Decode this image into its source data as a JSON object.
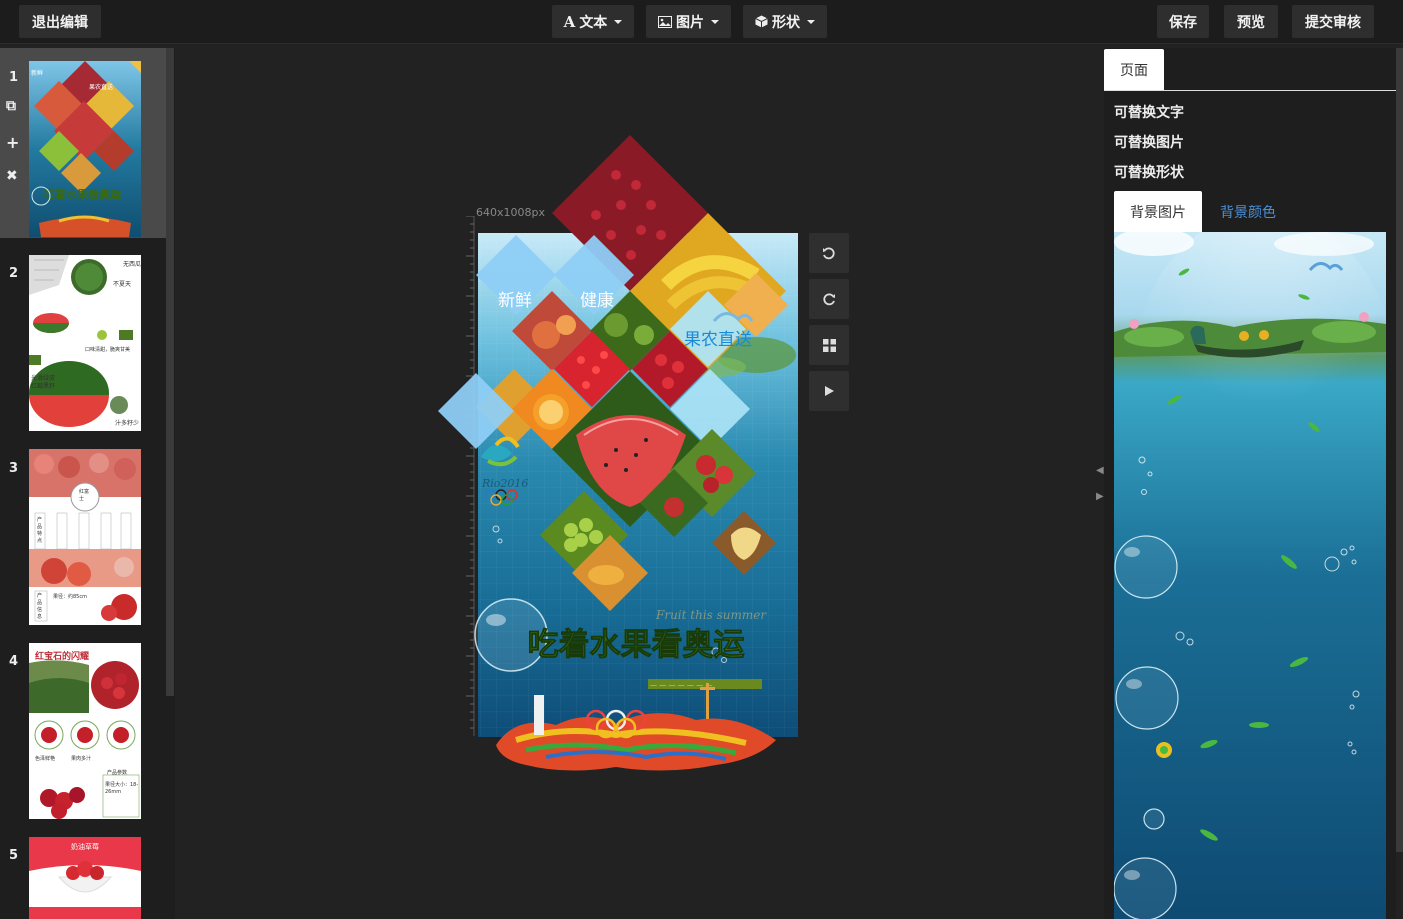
{
  "topbar": {
    "exit_label": "退出编辑",
    "text_label": "文本",
    "image_label": "图片",
    "shape_label": "形状",
    "save_label": "保存",
    "preview_label": "预览",
    "submit_label": "提交审核",
    "text_icon": "A"
  },
  "thumbnails": [
    {
      "num": "1"
    },
    {
      "num": "2",
      "t1": "无西瓜",
      "t2": "不夏天",
      "t3": "口味清甜，脆爽甘美",
      "t4": "光滑绿皮",
      "t5": "红瓤黑籽",
      "t6": "汁多籽少"
    },
    {
      "num": "3",
      "t1": "红富士",
      "t2": "产品特点",
      "t3": "果径：约85cm",
      "t4": "产品信息"
    },
    {
      "num": "4",
      "title": "红宝石的闪耀",
      "t1": "色泽鲜艳",
      "t2": "果肉多汁",
      "t3": "产品参数",
      "t4": "果径大小：18-26mm"
    },
    {
      "num": "5",
      "title": "奶油草莓"
    }
  ],
  "canvas": {
    "size_label": "640x1008px",
    "word_fresh": "新鲜",
    "word_health": "健康",
    "word_direct": "果农直送",
    "title": "吃着水果看奥运",
    "script_text": "Fruit this summer",
    "rio_text": "Rio2016"
  },
  "right": {
    "tab_page": "页面",
    "replace_text": "可替换文字",
    "replace_image": "可替换图片",
    "replace_shape": "可替换形状",
    "bg_image_tab": "背景图片",
    "bg_color_tab": "背景颜色"
  }
}
